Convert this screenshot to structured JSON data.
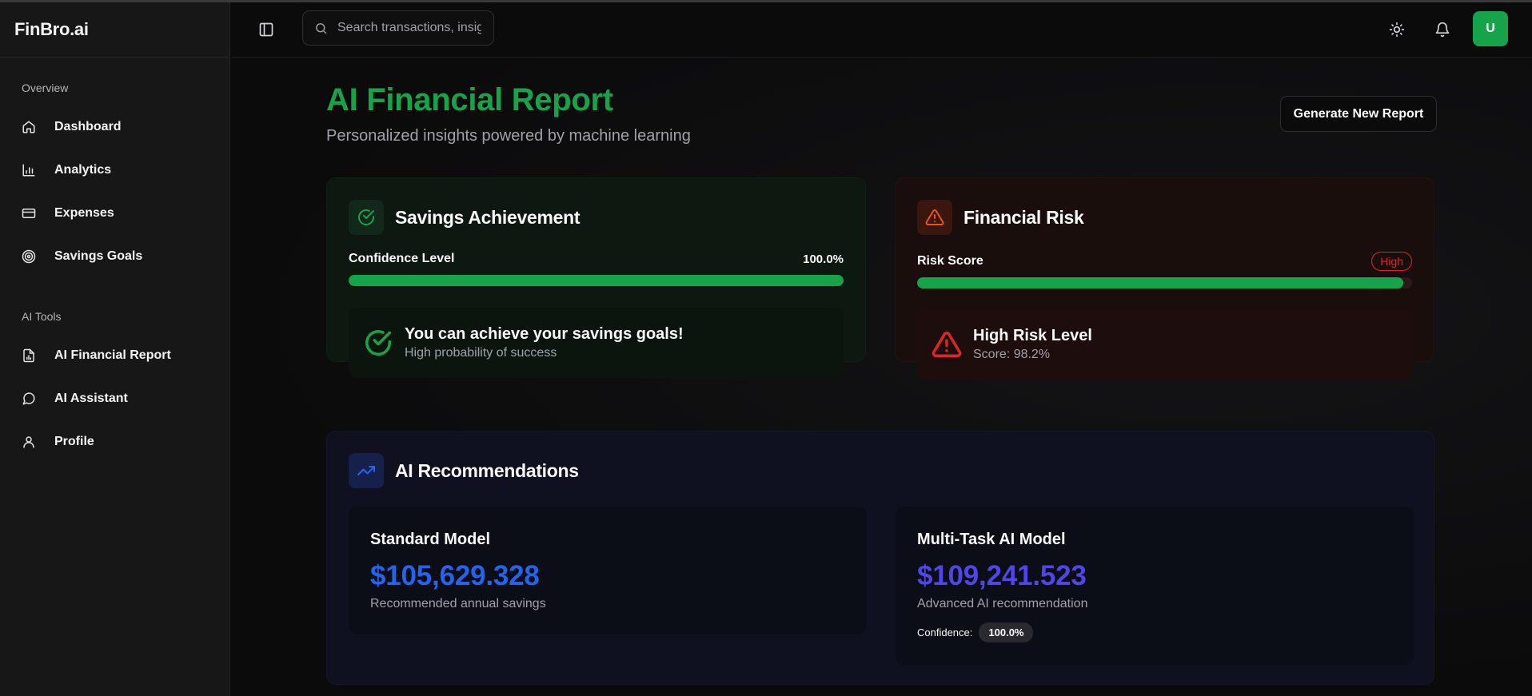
{
  "brand": "FinBro.ai",
  "sidebar": {
    "sections": [
      {
        "label": "Overview",
        "items": [
          {
            "label": "Dashboard",
            "icon": "home-icon"
          },
          {
            "label": "Analytics",
            "icon": "bar-chart-icon"
          },
          {
            "label": "Expenses",
            "icon": "credit-card-icon"
          },
          {
            "label": "Savings Goals",
            "icon": "target-icon"
          }
        ]
      },
      {
        "label": "AI Tools",
        "items": [
          {
            "label": "AI Financial Report",
            "icon": "file-chart-icon"
          },
          {
            "label": "AI Assistant",
            "icon": "chat-bubble-icon"
          },
          {
            "label": "Profile",
            "icon": "user-icon"
          }
        ]
      }
    ]
  },
  "topbar": {
    "search_placeholder": "Search transactions, insights...",
    "avatar_initial": "U"
  },
  "page": {
    "title": "AI Financial Report",
    "subtitle": "Personalized insights powered by machine learning",
    "generate_button": "Generate New Report"
  },
  "savings": {
    "title": "Savings Achievement",
    "meter_label": "Confidence Level",
    "meter_value": "100.0%",
    "meter_fraction": 1.0,
    "message_title": "You can achieve your savings goals!",
    "message_sub": "High probability of success"
  },
  "risk": {
    "title": "Financial Risk",
    "meter_label": "Risk Score",
    "badge": "High",
    "meter_fraction": 0.982,
    "message_title": "High Risk Level",
    "message_sub": "Score: 98.2%"
  },
  "recommendations": {
    "title": "AI Recommendations",
    "standard": {
      "name": "Standard Model",
      "value": "$105,629.328",
      "description": "Recommended annual savings"
    },
    "multitask": {
      "name": "Multi-Task AI Model",
      "value": "$109,241.523",
      "description": "Advanced AI recommendation",
      "confidence_label": "Confidence:",
      "confidence_value": "100.0%"
    }
  },
  "colors": {
    "accent_green": "#16a34a",
    "risk_red": "#dc2626",
    "reco_blue": "#2563eb",
    "reco_indigo": "#4f46e5"
  }
}
